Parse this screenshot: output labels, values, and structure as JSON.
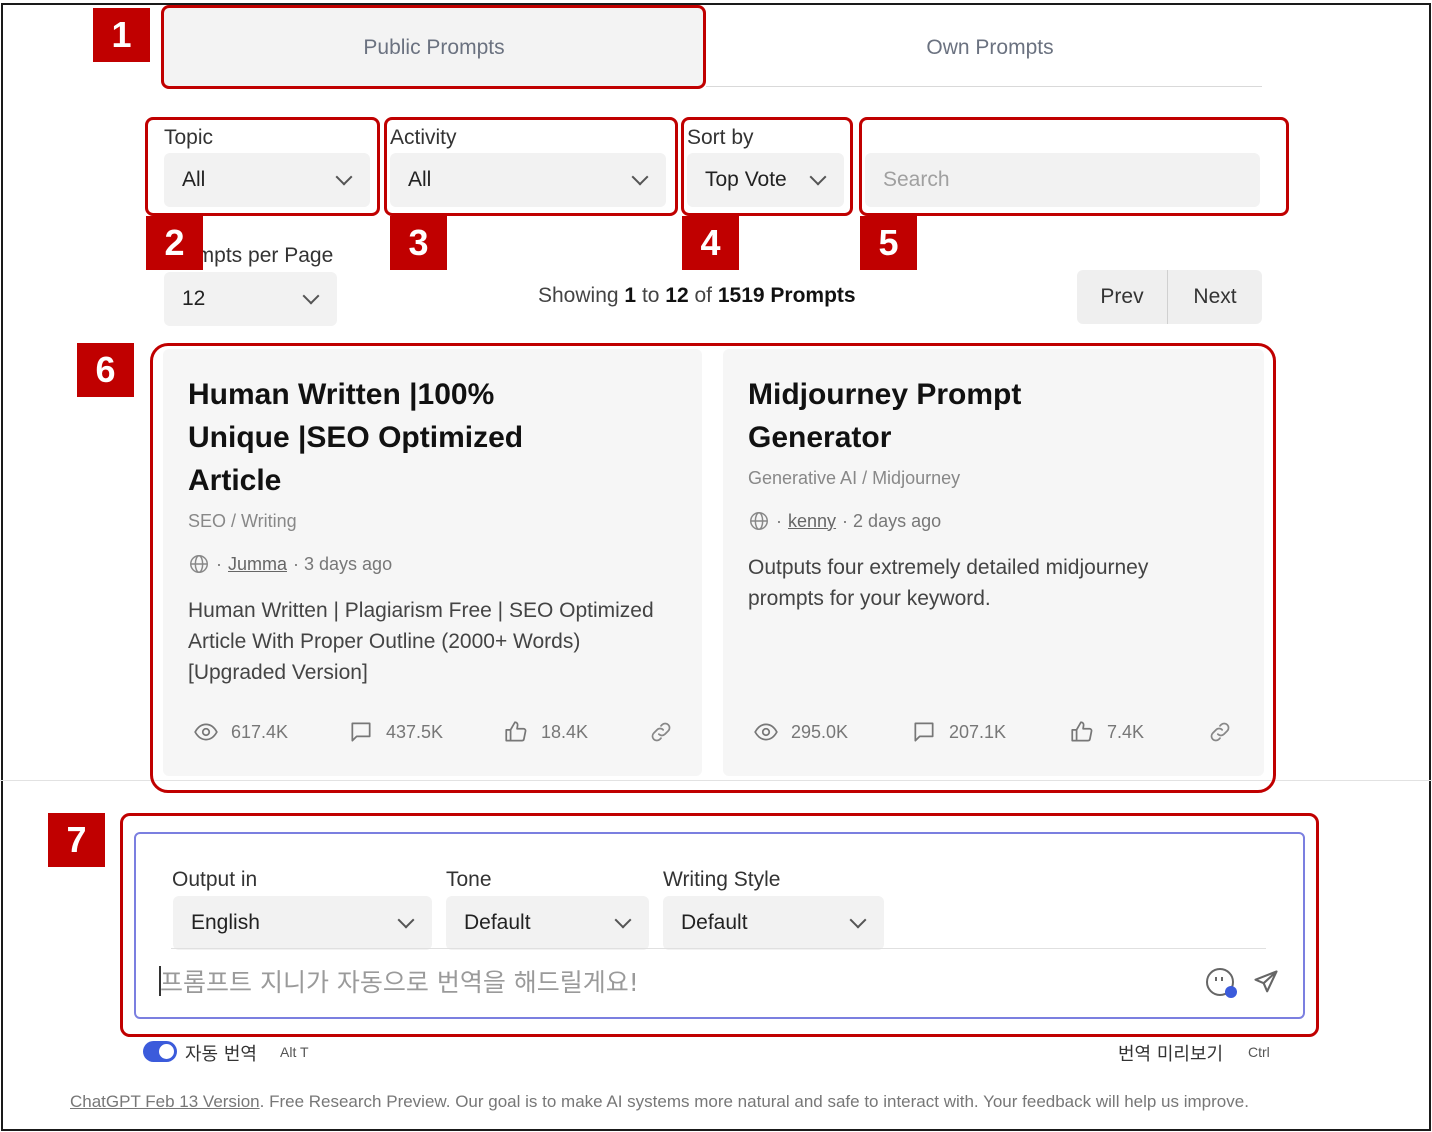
{
  "tabs": [
    {
      "label": "Public Prompts",
      "active": true
    },
    {
      "label": "Own Prompts",
      "active": false
    }
  ],
  "filters": {
    "topic": {
      "label": "Topic",
      "value": "All"
    },
    "activity": {
      "label": "Activity",
      "value": "All"
    },
    "sort": {
      "label": "Sort by",
      "value": "Top Votes"
    },
    "search": {
      "placeholder": "Search",
      "value": ""
    },
    "per_page": {
      "label": "Prompts per Page",
      "value": "12"
    }
  },
  "showing": {
    "prefix": "Showing",
    "from": "1",
    "to_word": "to",
    "to": "12",
    "of_word": "of",
    "total": "1519 Prompts"
  },
  "pager": {
    "prev": "Prev",
    "next": "Next"
  },
  "cards": [
    {
      "title_lines": [
        "Human Written |100%",
        "Unique |SEO Optimized",
        "Article"
      ],
      "category": "SEO / Writing",
      "author": "Jumma",
      "time": "· 3 days ago",
      "desc_lines": [
        "Human Written | Plagiarism Free | SEO Optimized",
        "Article With Proper Outline (2000+ Words)",
        "[Upgraded Version]"
      ],
      "views": "617.4K",
      "comments": "437.5K",
      "likes": "18.4K"
    },
    {
      "title_lines": [
        "Midjourney Prompt",
        "Generator"
      ],
      "category": "Generative AI / Midjourney",
      "author": "kenny",
      "time": "· 2 days ago",
      "desc_lines": [
        "Outputs four extremely detailed midjourney",
        "prompts for your keyword."
      ],
      "views": "295.0K",
      "comments": "207.1K",
      "likes": "7.4K"
    }
  ],
  "composer": {
    "output": {
      "label": "Output in",
      "value": "English"
    },
    "tone": {
      "label": "Tone",
      "value": "Default"
    },
    "style": {
      "label": "Writing Style",
      "value": "Default"
    },
    "placeholder": "프롬프트 지니가 자동으로 번역을 해드릴게요!"
  },
  "bottom_bar": {
    "auto_translate": "자동 번역",
    "auto_translate_shortcut": "Alt T",
    "preview": "번역 미리보기",
    "preview_shortcut": "Ctrl"
  },
  "footer": {
    "link": "ChatGPT Feb 13 Version",
    "text": ". Free Research Preview. Our goal is to make AI systems more natural and safe to interact with. Your feedback will help us improve."
  },
  "annotations": [
    "1",
    "2",
    "3",
    "4",
    "5",
    "6",
    "7"
  ],
  "colors": {
    "annotation_red": "#c00000",
    "composer_border": "#7b7fe0",
    "toggle_blue": "#3b5bdb"
  }
}
